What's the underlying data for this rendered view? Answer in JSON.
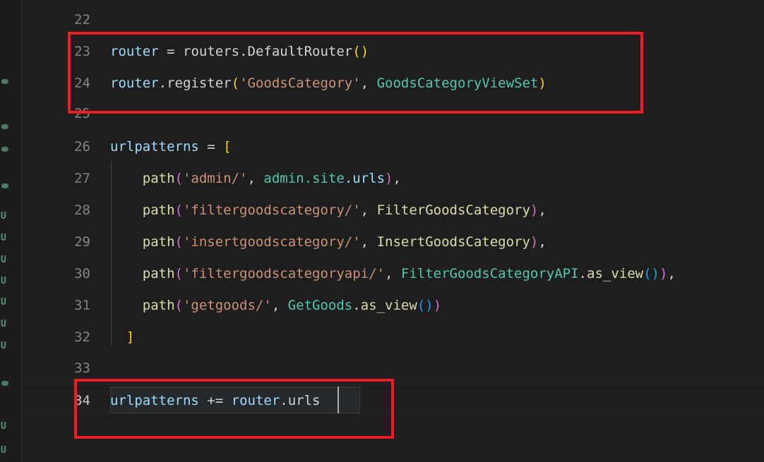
{
  "editor": {
    "background_color": "#1e1e1e",
    "language": "python",
    "active_line": 34,
    "cursor": {
      "line": 34,
      "column": 31
    },
    "gutter": {
      "line_numbers": [
        "22",
        "23",
        "24",
        "25",
        "26",
        "27",
        "28",
        "29",
        "30",
        "31",
        "32",
        "33",
        "34"
      ]
    },
    "lines": [
      {
        "number": "22",
        "tokens": []
      },
      {
        "number": "23",
        "tokens": [
          {
            "text": "router",
            "cls": "t-var"
          },
          {
            "text": " ",
            "cls": "t-plain"
          },
          {
            "text": "=",
            "cls": "t-op"
          },
          {
            "text": " ",
            "cls": "t-plain"
          },
          {
            "text": "routers",
            "cls": "t-plain"
          },
          {
            "text": ".",
            "cls": "t-plain"
          },
          {
            "text": "DefaultRouter",
            "cls": "t-plain"
          },
          {
            "text": "(",
            "cls": "t-y"
          },
          {
            "text": ")",
            "cls": "t-y"
          }
        ]
      },
      {
        "number": "24",
        "tokens": [
          {
            "text": "router",
            "cls": "t-var"
          },
          {
            "text": ".",
            "cls": "t-plain"
          },
          {
            "text": "register",
            "cls": "t-plain"
          },
          {
            "text": "(",
            "cls": "t-y"
          },
          {
            "text": "'GoodsCategory'",
            "cls": "t-str"
          },
          {
            "text": ",",
            "cls": "t-plain"
          },
          {
            "text": " ",
            "cls": "t-plain"
          },
          {
            "text": "GoodsCategoryViewSet",
            "cls": "t-type"
          },
          {
            "text": ")",
            "cls": "t-y"
          }
        ]
      },
      {
        "number": "25",
        "tokens": []
      },
      {
        "number": "26",
        "tokens": [
          {
            "text": "urlpatterns",
            "cls": "t-var"
          },
          {
            "text": " ",
            "cls": "t-plain"
          },
          {
            "text": "=",
            "cls": "t-op"
          },
          {
            "text": " ",
            "cls": "t-plain"
          },
          {
            "text": "[",
            "cls": "t-y"
          }
        ]
      },
      {
        "number": "27",
        "tokens": [
          {
            "text": "    ",
            "cls": "t-plain"
          },
          {
            "text": "path",
            "cls": "t-func"
          },
          {
            "text": "(",
            "cls": "t-m"
          },
          {
            "text": "'admin/'",
            "cls": "t-str"
          },
          {
            "text": ",",
            "cls": "t-plain"
          },
          {
            "text": " ",
            "cls": "t-plain"
          },
          {
            "text": "admin",
            "cls": "t-type"
          },
          {
            "text": ".",
            "cls": "t-type"
          },
          {
            "text": "site",
            "cls": "t-type"
          },
          {
            "text": ".",
            "cls": "t-prop"
          },
          {
            "text": "urls",
            "cls": "t-prop"
          },
          {
            "text": ")",
            "cls": "t-m"
          },
          {
            "text": ",",
            "cls": "t-plain"
          }
        ]
      },
      {
        "number": "28",
        "tokens": [
          {
            "text": "    ",
            "cls": "t-plain"
          },
          {
            "text": "path",
            "cls": "t-func"
          },
          {
            "text": "(",
            "cls": "t-m"
          },
          {
            "text": "'filtergoodscategory/'",
            "cls": "t-str"
          },
          {
            "text": ",",
            "cls": "t-plain"
          },
          {
            "text": " ",
            "cls": "t-plain"
          },
          {
            "text": "FilterGoodsCategory",
            "cls": "t-func"
          },
          {
            "text": ")",
            "cls": "t-m"
          },
          {
            "text": ",",
            "cls": "t-plain"
          }
        ]
      },
      {
        "number": "29",
        "tokens": [
          {
            "text": "    ",
            "cls": "t-plain"
          },
          {
            "text": "path",
            "cls": "t-func"
          },
          {
            "text": "(",
            "cls": "t-m"
          },
          {
            "text": "'insertgoodscategory/'",
            "cls": "t-str"
          },
          {
            "text": ",",
            "cls": "t-plain"
          },
          {
            "text": " ",
            "cls": "t-plain"
          },
          {
            "text": "InsertGoodsCategory",
            "cls": "t-func"
          },
          {
            "text": ")",
            "cls": "t-m"
          },
          {
            "text": ",",
            "cls": "t-plain"
          }
        ]
      },
      {
        "number": "30",
        "tokens": [
          {
            "text": "    ",
            "cls": "t-plain"
          },
          {
            "text": "path",
            "cls": "t-func"
          },
          {
            "text": "(",
            "cls": "t-m"
          },
          {
            "text": "'filtergoodscategoryapi/'",
            "cls": "t-str"
          },
          {
            "text": ",",
            "cls": "t-plain"
          },
          {
            "text": " ",
            "cls": "t-plain"
          },
          {
            "text": "FilterGoodsCategoryAPI",
            "cls": "t-type"
          },
          {
            "text": ".",
            "cls": "t-plain"
          },
          {
            "text": "as_view",
            "cls": "t-func"
          },
          {
            "text": "(",
            "cls": "t-b"
          },
          {
            "text": ")",
            "cls": "t-b"
          },
          {
            "text": ")",
            "cls": "t-m"
          },
          {
            "text": ",",
            "cls": "t-plain"
          }
        ]
      },
      {
        "number": "31",
        "tokens": [
          {
            "text": "    ",
            "cls": "t-plain"
          },
          {
            "text": "path",
            "cls": "t-func"
          },
          {
            "text": "(",
            "cls": "t-m"
          },
          {
            "text": "'getgoods/'",
            "cls": "t-str"
          },
          {
            "text": ",",
            "cls": "t-plain"
          },
          {
            "text": " ",
            "cls": "t-plain"
          },
          {
            "text": "GetGoods",
            "cls": "t-type"
          },
          {
            "text": ".",
            "cls": "t-plain"
          },
          {
            "text": "as_view",
            "cls": "t-func"
          },
          {
            "text": "(",
            "cls": "t-b"
          },
          {
            "text": ")",
            "cls": "t-b"
          },
          {
            "text": ")",
            "cls": "t-m"
          }
        ]
      },
      {
        "number": "32",
        "tokens": [
          {
            "text": "  ",
            "cls": "t-plain"
          },
          {
            "text": "]",
            "cls": "t-y"
          }
        ]
      },
      {
        "number": "33",
        "tokens": []
      },
      {
        "number": "34",
        "tokens": [
          {
            "text": "urlpatterns",
            "cls": "t-var"
          },
          {
            "text": " ",
            "cls": "t-plain"
          },
          {
            "text": "+=",
            "cls": "t-op"
          },
          {
            "text": " ",
            "cls": "t-plain"
          },
          {
            "text": "router",
            "cls": "t-var"
          },
          {
            "text": ".",
            "cls": "t-plain"
          },
          {
            "text": "urls",
            "cls": "t-plain"
          }
        ]
      }
    ],
    "plain_text_lines": [
      "",
      "router = routers.DefaultRouter()",
      "router.register('GoodsCategory', GoodsCategoryViewSet)",
      "",
      "urlpatterns = [",
      "    path('admin/', admin.site.urls),",
      "    path('filtergoodscategory/', FilterGoodsCategory),",
      "    path('insertgoodscategory/', InsertGoodsCategory),",
      "    path('filtergoodscategoryapi/', FilterGoodsCategoryAPI.as_view()),",
      "    path('getgoods/', GetGoods.as_view())",
      "  ]",
      "",
      "urlpatterns += router.urls"
    ]
  },
  "minimap": {
    "marks": [
      "U",
      "U",
      "U",
      "U",
      "U",
      "U",
      "U",
      "U"
    ],
    "color": "#5f9e7e"
  },
  "annotations": {
    "color": "#f31b24",
    "boxes": [
      {
        "label": "router-registration-highlight",
        "lines": "23-24"
      },
      {
        "label": "urlpatterns-append-highlight",
        "lines": "34"
      }
    ]
  }
}
